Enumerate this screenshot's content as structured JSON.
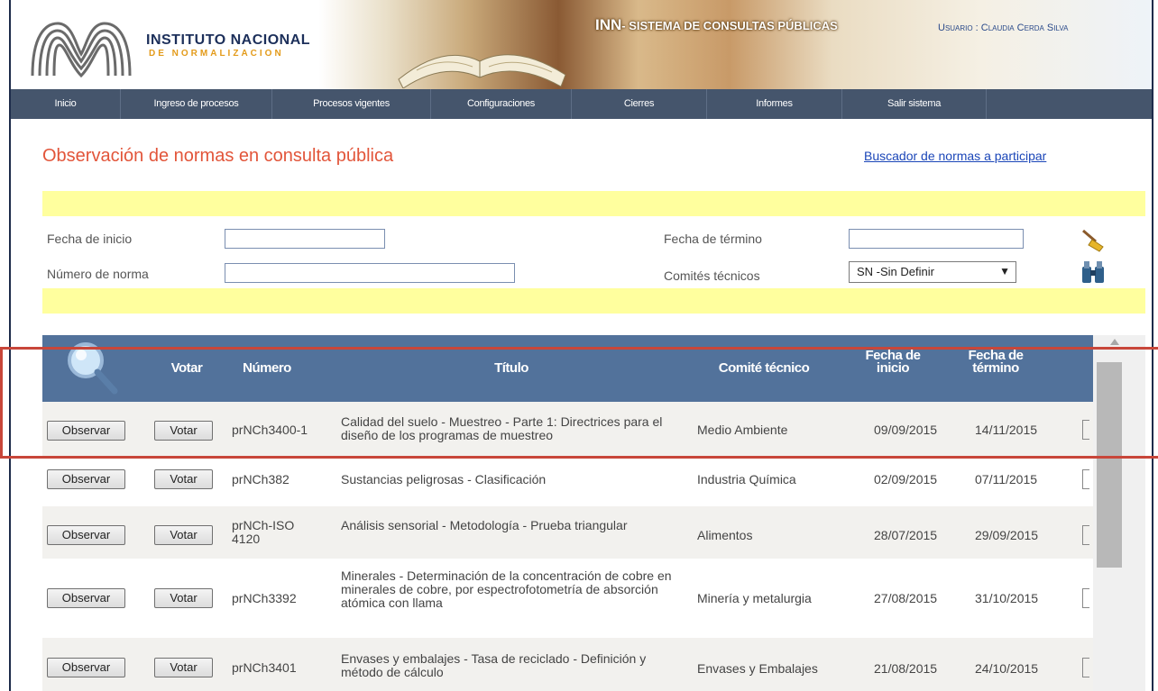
{
  "header": {
    "org_name_line1": "INSTITUTO NACIONAL",
    "org_name_line2": "DE NORMALIZACION",
    "system_prefix": "INN",
    "system_title": "- SISTEMA DE CONSULTAS PÚBLICAS",
    "user_label": "Usuario : Claudia Cerda Silva"
  },
  "nav": {
    "items": [
      "Inicio",
      "Ingreso de procesos",
      "Procesos vigentes",
      "Configuraciones",
      "Cierres",
      "Informes",
      "Salir sistema"
    ]
  },
  "page": {
    "title": "Observación de normas en consulta pública",
    "finder_link": "Buscador de normas a participar"
  },
  "filters": {
    "start_date_label": "Fecha de inicio",
    "start_date_value": "",
    "end_date_label": "Fecha de término",
    "end_date_value": "",
    "norm_number_label": "Número de norma",
    "norm_number_value": "",
    "committee_label": "Comités técnicos",
    "committee_value": "SN -Sin Definir",
    "clear_icon": "broom-icon",
    "search_icon": "binoculars-icon"
  },
  "table": {
    "header_icon": "magnifier-icon",
    "columns": {
      "vote": "Votar",
      "number": "Número",
      "title": "Título",
      "committee": "Comité técnico",
      "start_line1": "Fecha de",
      "start_line2": "inicio",
      "end_line1": "Fecha de",
      "end_line2": "término"
    },
    "observe_label": "Observar",
    "vote_label": "Votar",
    "rows": [
      {
        "number": "prNCh3400-1",
        "title": "Calidad del suelo - Muestreo - Parte 1: Directrices para el diseño de los programas de muestreo",
        "committee": "Medio Ambiente",
        "start": "09/09/2015",
        "end": "14/11/2015"
      },
      {
        "number": "prNCh382",
        "title": "Sustancias peligrosas - Clasificación",
        "committee": "Industria Química",
        "start": "02/09/2015",
        "end": "07/11/2015"
      },
      {
        "number": "prNCh-ISO 4120",
        "title": "Análisis sensorial - Metodología - Prueba triangular",
        "committee": "Alimentos",
        "start": "28/07/2015",
        "end": "29/09/2015"
      },
      {
        "number": "prNCh3392",
        "title": "Minerales - Determinación de la concentración de cobre en minerales de cobre, por espectrofotometría de absorción atómica con llama",
        "committee": "Minería y metalurgia",
        "start": "27/08/2015",
        "end": "31/10/2015"
      },
      {
        "number": "prNCh3401",
        "title": "Envases y embalajes - Tasa de reciclado - Definición y método de cálculo",
        "committee": "Envases y Embalajes",
        "start": "21/08/2015",
        "end": "24/10/2015"
      }
    ]
  },
  "colors": {
    "nav_bg": "#45556c",
    "table_header_bg": "#52729b",
    "title_color": "#e2553a",
    "highlight_border": "#c8463a",
    "filter_band": "#ffff9e"
  }
}
